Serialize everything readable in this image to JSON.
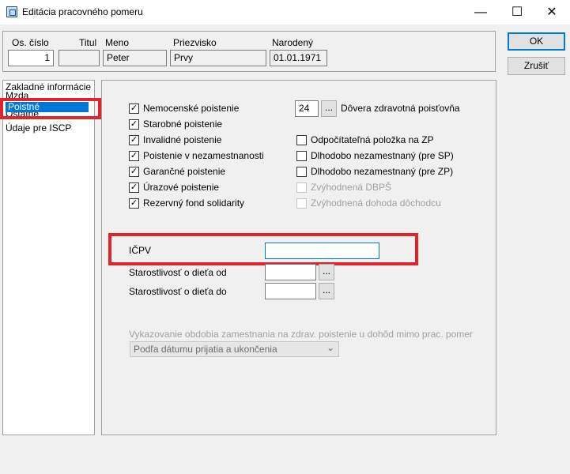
{
  "window": {
    "title": "Editácia pracovného pomeru",
    "minimize_glyph": "—",
    "maximize_glyph": "☐",
    "close_glyph": "✕"
  },
  "header": {
    "os_cislo_label": "Os. číslo",
    "os_cislo_value": "1",
    "titul_label": "Titul",
    "titul_value": "",
    "meno_label": "Meno",
    "meno_value": "Peter",
    "priezvisko_label": "Priezvisko",
    "priezvisko_value": "Prvy",
    "narodeny_label": "Narodený",
    "narodeny_value": "01.01.1971"
  },
  "buttons": {
    "ok": "OK",
    "cancel": "Zrušiť"
  },
  "nav": {
    "items": [
      "Zakladné informácie",
      "Mzda",
      "Poistné",
      "Ostatné",
      "Údaje pre ISCP"
    ],
    "selected": "Poistné"
  },
  "insurance": {
    "left": [
      {
        "label": "Nemocenské poistenie",
        "checked": true
      },
      {
        "label": "Starobné poistenie",
        "checked": true
      },
      {
        "label": "Invalidné poistenie",
        "checked": true
      },
      {
        "label": "Poistenie v nezamestnanosti",
        "checked": true
      },
      {
        "label": "Garančné poistenie",
        "checked": true
      },
      {
        "label": "Úrazové poistenie",
        "checked": true
      },
      {
        "label": "Rezervný fond solidarity",
        "checked": true
      }
    ],
    "health_code": "24",
    "health_label": "Dôvera zdravotná poisťovňa",
    "right": [
      {
        "label": "Odpočítateľná položka na ZP",
        "checked": false,
        "disabled": false
      },
      {
        "label": "Dlhodobo nezamestnaný (pre SP)",
        "checked": false,
        "disabled": false
      },
      {
        "label": "Dlhodobo nezamestnaný (pre ZP)",
        "checked": false,
        "disabled": false
      },
      {
        "label": "Zvýhodnená DBPŠ",
        "checked": false,
        "disabled": true
      },
      {
        "label": "Zvýhodnená dohoda dôchodcu",
        "checked": false,
        "disabled": true
      }
    ],
    "check_glyph": "✓",
    "dots": "..."
  },
  "icpv": {
    "label": "IČPV",
    "value": ""
  },
  "care": {
    "from_label": "Starostlivosť o dieťa od",
    "from_value": "",
    "to_label": "Starostlivosť o dieťa do",
    "to_value": ""
  },
  "reporting": {
    "label": "Vykazovanie obdobia zamestnania na zdrav. poistenie u dohôd mimo prac. pomer",
    "value": "Podľa dátumu prijatia a ukončenia",
    "arrow": "⌄"
  },
  "colors": {
    "selection": "#0078d7",
    "highlight": "#e0242b"
  }
}
